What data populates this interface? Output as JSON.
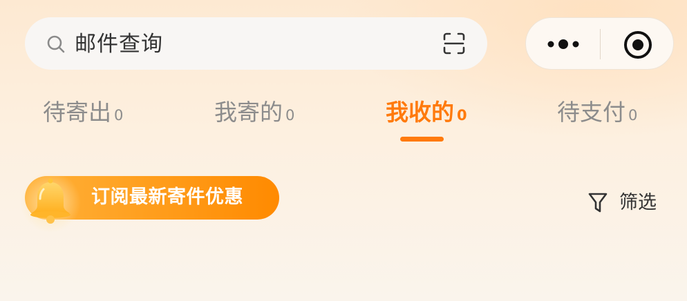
{
  "search": {
    "placeholder": "邮件查询",
    "scan_icon": "scan-icon",
    "search_icon": "search-icon"
  },
  "capsule": {
    "more_icon": "more-icon",
    "record_icon": "record-icon"
  },
  "tabs": [
    {
      "label": "待寄出",
      "count": "0",
      "active": false
    },
    {
      "label": "我寄的",
      "count": "0",
      "active": false
    },
    {
      "label": "我收的",
      "count": "0",
      "active": true
    },
    {
      "label": "待支付",
      "count": "0",
      "active": false
    }
  ],
  "banner": {
    "text": "订阅最新寄件优惠",
    "icon": "bell-icon"
  },
  "filter": {
    "label": "筛选",
    "icon": "filter-icon"
  },
  "colors": {
    "accent": "#ff7a0c",
    "tab_inactive": "#8c8c8c"
  }
}
